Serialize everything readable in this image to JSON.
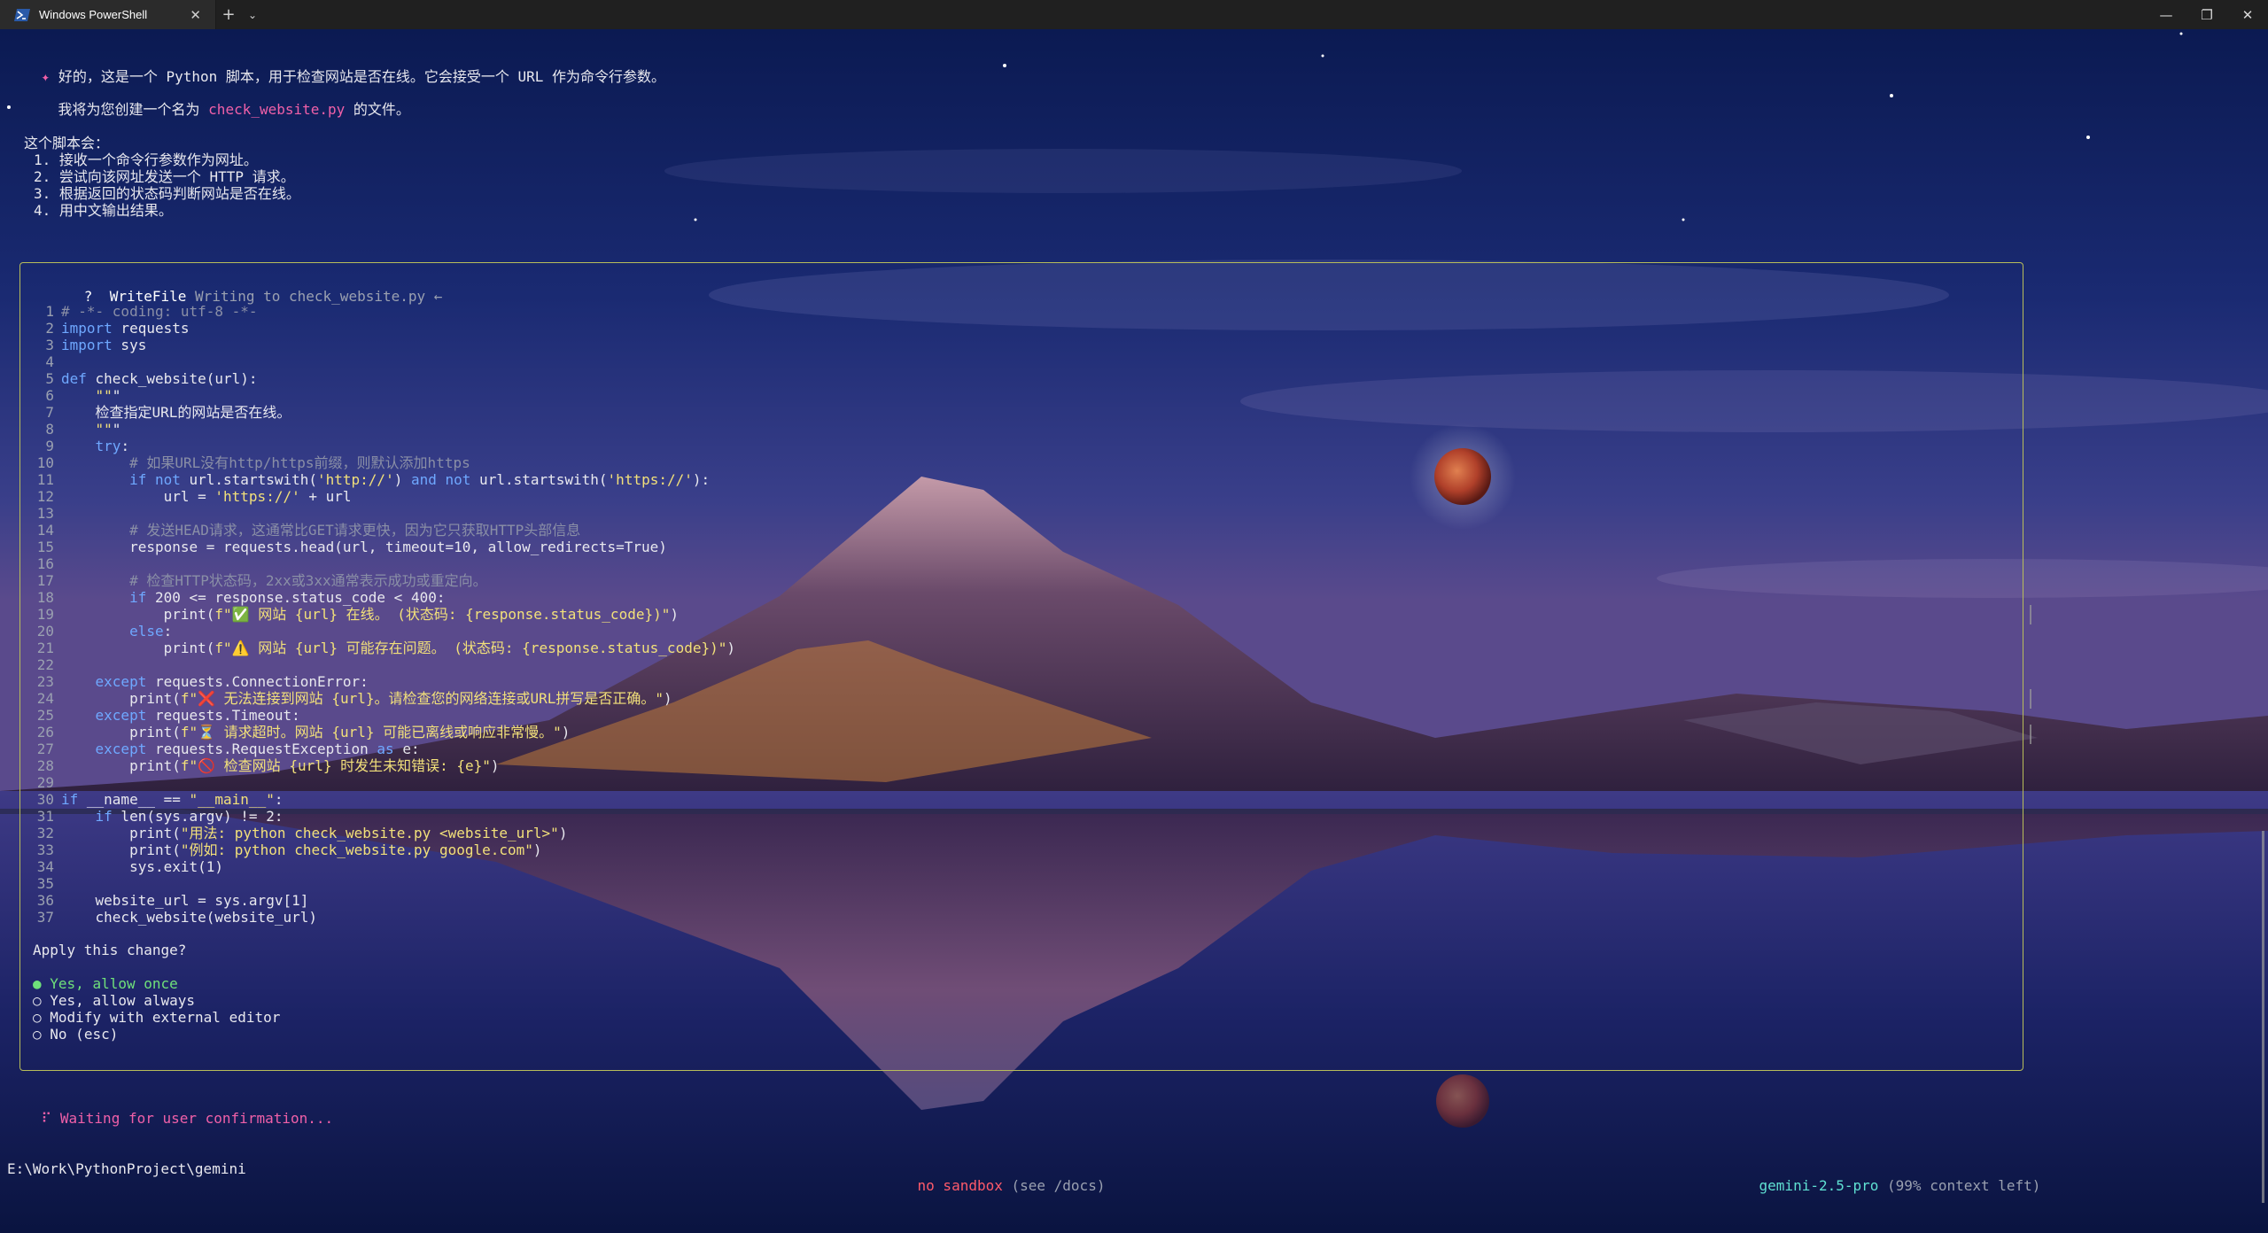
{
  "window": {
    "tab_title": "Windows PowerShell",
    "tab_close": "✕",
    "new_tab": "+",
    "tab_dropdown": "⌄",
    "minimize": "—",
    "restore": "❐",
    "close": "✕"
  },
  "intro": {
    "line1_bullet": "✦",
    "line1": "好的，这是一个 Python 脚本，用于检查网站是否在线。它会接受一个 URL 作为命令行参数。",
    "line2_prefix": "我将为您创建一个名为 ",
    "line2_file": "check_website.py",
    "line2_suffix": " 的文件。",
    "steps_title": "这个脚本会：",
    "steps": [
      "1. 接收一个命令行参数作为网址。",
      "2. 尝试向该网址发送一个 HTTP 请求。",
      "3. 根据返回的状态码判断网站是否在线。",
      "4. 用中文输出结果。"
    ]
  },
  "dialog": {
    "question_mark": "?",
    "tool_name": "WriteFile",
    "tool_desc": "Writing to check_website.py ←",
    "code_lines": [
      {
        "n": "1",
        "text": "# -*- coding: utf-8 -*-"
      },
      {
        "n": "2",
        "text": "import requests"
      },
      {
        "n": "3",
        "text": "import sys"
      },
      {
        "n": "4",
        "text": ""
      },
      {
        "n": "5",
        "text": "def check_website(url):"
      },
      {
        "n": "6",
        "text": "    \"\"\""
      },
      {
        "n": "7",
        "text": "    检查指定URL的网站是否在线。"
      },
      {
        "n": "8",
        "text": "    \"\"\""
      },
      {
        "n": "9",
        "text": "    try:"
      },
      {
        "n": "10",
        "text": "        # 如果URL没有http/https前缀，则默认添加https"
      },
      {
        "n": "11",
        "text": "        if not url.startswith('http://') and not url.startswith('https://'):"
      },
      {
        "n": "12",
        "text": "            url = 'https://' + url"
      },
      {
        "n": "13",
        "text": ""
      },
      {
        "n": "14",
        "text": "        # 发送HEAD请求，这通常比GET请求更快，因为它只获取HTTP头部信息"
      },
      {
        "n": "15",
        "text": "        response = requests.head(url, timeout=10, allow_redirects=True)"
      },
      {
        "n": "16",
        "text": ""
      },
      {
        "n": "17",
        "text": "        # 检查HTTP状态码，2xx或3xx通常表示成功或重定向。"
      },
      {
        "n": "18",
        "text": "        if 200 <= response.status_code < 400:"
      },
      {
        "n": "19",
        "text": "            print(f\"✅ 网站 {url} 在线。 (状态码: {response.status_code})\")"
      },
      {
        "n": "20",
        "text": "        else:"
      },
      {
        "n": "21",
        "text": "            print(f\"⚠️ 网站 {url} 可能存在问题。 (状态码: {response.status_code})\")"
      },
      {
        "n": "22",
        "text": ""
      },
      {
        "n": "23",
        "text": "    except requests.ConnectionError:"
      },
      {
        "n": "24",
        "text": "        print(f\"❌ 无法连接到网站 {url}。请检查您的网络连接或URL拼写是否正确。\")"
      },
      {
        "n": "25",
        "text": "    except requests.Timeout:"
      },
      {
        "n": "26",
        "text": "        print(f\"⏳ 请求超时。网站 {url} 可能已离线或响应非常慢。\")"
      },
      {
        "n": "27",
        "text": "    except requests.RequestException as e:"
      },
      {
        "n": "28",
        "text": "        print(f\"🚫 检查网站 {url} 时发生未知错误: {e}\")"
      },
      {
        "n": "29",
        "text": ""
      },
      {
        "n": "30",
        "text": "if __name__ == \"__main__\":"
      },
      {
        "n": "31",
        "text": "    if len(sys.argv) != 2:"
      },
      {
        "n": "32",
        "text": "        print(\"用法: python check_website.py <website_url>\")"
      },
      {
        "n": "33",
        "text": "        print(\"例如: python check_website.py google.com\")"
      },
      {
        "n": "34",
        "text": "        sys.exit(1)"
      },
      {
        "n": "35",
        "text": ""
      },
      {
        "n": "36",
        "text": "    website_url = sys.argv[1]"
      },
      {
        "n": "37",
        "text": "    check_website(website_url)"
      }
    ],
    "apply_question": "Apply this change?",
    "options": [
      {
        "marker": "●",
        "label": "Yes, allow once",
        "selected": true
      },
      {
        "marker": "○",
        "label": "Yes, allow always",
        "selected": false
      },
      {
        "marker": "○",
        "label": "Modify with external editor",
        "selected": false
      },
      {
        "marker": "○",
        "label": "No (esc)",
        "selected": false
      }
    ]
  },
  "status": {
    "spinner": "⠏",
    "waiting": "Waiting for user confirmation...",
    "cwd": "E:\\Work\\PythonProject\\gemini",
    "sandbox": "no sandbox",
    "sandbox_hint": " (see /docs)",
    "model": "gemini-2.5-pro",
    "context": " (99% context left)"
  },
  "colors": {
    "accent_pink": "#f060a8",
    "dialog_border": "#b8bd5a",
    "selected_option": "#6fe07a",
    "sandbox_red": "#ff5a6a",
    "model_teal": "#5fe0d2"
  }
}
